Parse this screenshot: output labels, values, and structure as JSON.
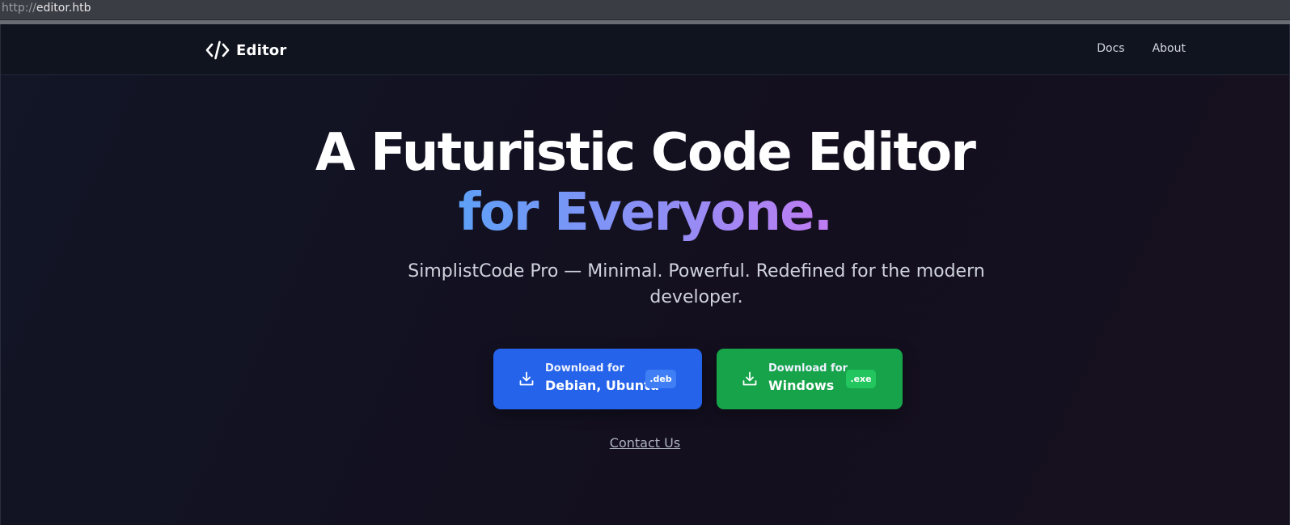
{
  "browser": {
    "url_scheme": "http://",
    "url_host": "editor.htb"
  },
  "navbar": {
    "brand_name": "Editor",
    "links": [
      "Docs",
      "About"
    ]
  },
  "hero": {
    "title_line1": "A Futuristic Code Editor",
    "title_line2": "for Everyone.",
    "subtitle": "SimplistCode Pro — Minimal. Powerful. Redefined for the modern developer."
  },
  "downloads": [
    {
      "line1": "Download for",
      "line2": "Debian, Ubuntu",
      "badge": ".deb",
      "color": "#2563eb"
    },
    {
      "line1": "Download for",
      "line2": "Windows",
      "badge": ".exe",
      "color": "#16a34a"
    }
  ],
  "contact_label": "Contact Us",
  "colors": {
    "background": "#111320",
    "accent_blue": "#2563eb",
    "accent_green": "#16a34a",
    "gradient_start": "#5ea0f7",
    "gradient_end": "#c07cf2"
  },
  "icons": {
    "brand": "code-brackets-icon",
    "download": "download-icon"
  }
}
